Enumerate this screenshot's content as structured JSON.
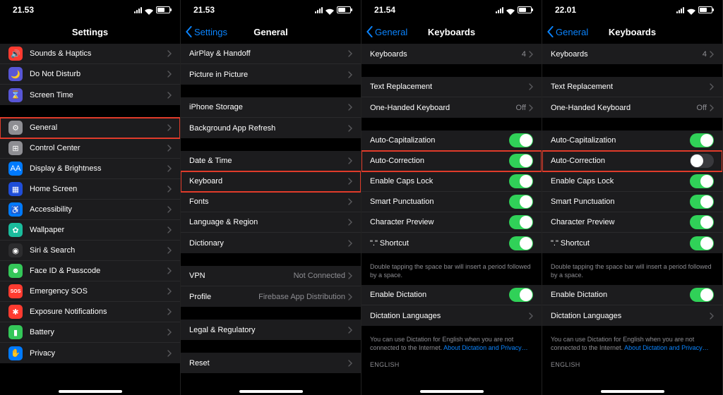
{
  "screen1": {
    "time": "21.53",
    "title": "Settings",
    "groupA": [
      {
        "label": "Sounds & Haptics",
        "icon": "sounds-icon",
        "bg": "bg-red"
      },
      {
        "label": "Do Not Disturb",
        "icon": "dnd-icon",
        "bg": "bg-purple"
      },
      {
        "label": "Screen Time",
        "icon": "screentime-icon",
        "bg": "bg-purple"
      }
    ],
    "groupB": [
      {
        "label": "General",
        "icon": "gear-icon",
        "bg": "bg-grey",
        "highlight": true
      },
      {
        "label": "Control Center",
        "icon": "control-center-icon",
        "bg": "bg-grey"
      },
      {
        "label": "Display & Brightness",
        "icon": "display-icon",
        "bg": "bg-blue"
      },
      {
        "label": "Home Screen",
        "icon": "home-icon",
        "bg": "bg-darkblue"
      },
      {
        "label": "Accessibility",
        "icon": "accessibility-icon",
        "bg": "bg-blue"
      },
      {
        "label": "Wallpaper",
        "icon": "wallpaper-icon",
        "bg": "bg-teal"
      },
      {
        "label": "Siri & Search",
        "icon": "siri-icon",
        "bg": "bg-black"
      },
      {
        "label": "Face ID & Passcode",
        "icon": "faceid-icon",
        "bg": "bg-green"
      },
      {
        "label": "Emergency SOS",
        "icon": "sos-icon",
        "bg": "bg-red"
      },
      {
        "label": "Exposure Notifications",
        "icon": "exposure-icon",
        "bg": "bg-red"
      },
      {
        "label": "Battery",
        "icon": "battery-icon",
        "bg": "bg-green"
      },
      {
        "label": "Privacy",
        "icon": "privacy-icon",
        "bg": "bg-blue"
      }
    ]
  },
  "screen2": {
    "time": "21.53",
    "back": "Settings",
    "title": "General",
    "groupA": [
      {
        "label": "AirPlay & Handoff"
      },
      {
        "label": "Picture in Picture"
      }
    ],
    "groupB": [
      {
        "label": "iPhone Storage"
      },
      {
        "label": "Background App Refresh"
      }
    ],
    "groupC": [
      {
        "label": "Date & Time"
      },
      {
        "label": "Keyboard",
        "highlight": true
      },
      {
        "label": "Fonts"
      },
      {
        "label": "Language & Region"
      },
      {
        "label": "Dictionary"
      }
    ],
    "groupD": [
      {
        "label": "VPN",
        "detail": "Not Connected"
      },
      {
        "label": "Profile",
        "detail": "Firebase App Distribution"
      }
    ],
    "groupE": [
      {
        "label": "Legal & Regulatory"
      }
    ],
    "groupF": [
      {
        "label": "Reset"
      }
    ]
  },
  "screen3": {
    "time": "21.54",
    "back": "General",
    "title": "Keyboards",
    "keyboards": {
      "label": "Keyboards",
      "detail": "4"
    },
    "groupA": [
      {
        "label": "Text Replacement"
      },
      {
        "label": "One-Handed Keyboard",
        "detail": "Off"
      }
    ],
    "toggles": [
      {
        "label": "Auto-Capitalization",
        "on": true
      },
      {
        "label": "Auto-Correction",
        "on": true,
        "highlight": true
      },
      {
        "label": "Enable Caps Lock",
        "on": true
      },
      {
        "label": "Smart Punctuation",
        "on": true
      },
      {
        "label": "Character Preview",
        "on": true
      },
      {
        "label": "\".\" Shortcut",
        "on": true
      }
    ],
    "shortcut_footer": "Double tapping the space bar will insert a period followed by a space.",
    "dictation": [
      {
        "label": "Enable Dictation",
        "on": true
      },
      {
        "label": "Dictation Languages"
      }
    ],
    "dictation_footer": "You can use Dictation for English when you are not connected to the Internet.",
    "dictation_link": "About Dictation and Privacy…",
    "section_header": "ENGLISH"
  },
  "screen4": {
    "time": "22.01",
    "back": "General",
    "title": "Keyboards",
    "keyboards": {
      "label": "Keyboards",
      "detail": "4"
    },
    "groupA": [
      {
        "label": "Text Replacement"
      },
      {
        "label": "One-Handed Keyboard",
        "detail": "Off"
      }
    ],
    "toggles": [
      {
        "label": "Auto-Capitalization",
        "on": true
      },
      {
        "label": "Auto-Correction",
        "on": false,
        "highlight": true
      },
      {
        "label": "Enable Caps Lock",
        "on": true
      },
      {
        "label": "Smart Punctuation",
        "on": true
      },
      {
        "label": "Character Preview",
        "on": true
      },
      {
        "label": "\".\" Shortcut",
        "on": true
      }
    ],
    "shortcut_footer": "Double tapping the space bar will insert a period followed by a space.",
    "dictation": [
      {
        "label": "Enable Dictation",
        "on": true
      },
      {
        "label": "Dictation Languages"
      }
    ],
    "dictation_footer": "You can use Dictation for English when you are not connected to the Internet.",
    "dictation_link": "About Dictation and Privacy…",
    "section_header": "ENGLISH"
  }
}
